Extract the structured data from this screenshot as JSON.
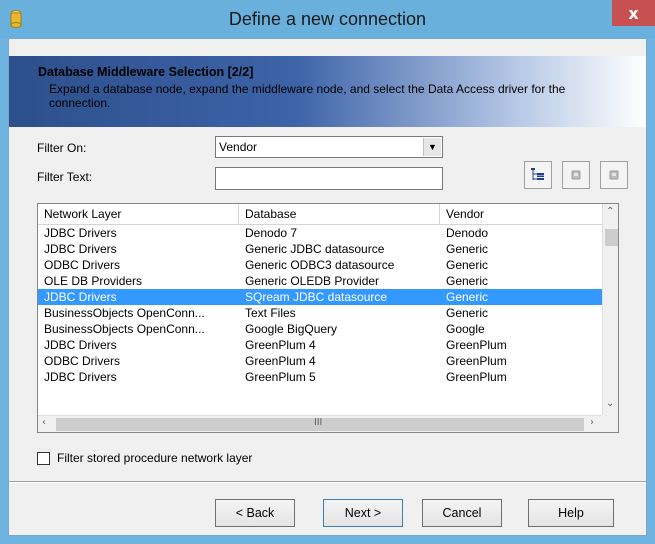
{
  "window": {
    "title": "Define a new connection",
    "close_label": "x"
  },
  "header": {
    "title": "Database Middleware Selection [2/2]",
    "description": "Expand a database node, expand the middleware node, and select the Data Access driver for the connection."
  },
  "filter": {
    "filter_on_label": "Filter On:",
    "filter_on_value": "Vendor",
    "filter_text_label": "Filter Text:",
    "filter_text_value": ""
  },
  "grid": {
    "columns": [
      "Network Layer",
      "Database",
      "Vendor"
    ],
    "rows": [
      {
        "network_layer": "JDBC Drivers",
        "database": "Denodo 7",
        "vendor": "Denodo",
        "selected": false
      },
      {
        "network_layer": "JDBC Drivers",
        "database": "Generic JDBC datasource",
        "vendor": "Generic",
        "selected": false
      },
      {
        "network_layer": "ODBC Drivers",
        "database": "Generic ODBC3 datasource",
        "vendor": "Generic",
        "selected": false
      },
      {
        "network_layer": "OLE DB Providers",
        "database": "Generic OLEDB Provider",
        "vendor": "Generic",
        "selected": false
      },
      {
        "network_layer": "JDBC Drivers",
        "database": "SQream JDBC datasource",
        "vendor": "Generic",
        "selected": true
      },
      {
        "network_layer": "BusinessObjects OpenConn...",
        "database": "Text Files",
        "vendor": "Generic",
        "selected": false
      },
      {
        "network_layer": "BusinessObjects OpenConn...",
        "database": "Google BigQuery",
        "vendor": "Google",
        "selected": false
      },
      {
        "network_layer": "JDBC Drivers",
        "database": "GreenPlum 4",
        "vendor": "GreenPlum",
        "selected": false
      },
      {
        "network_layer": "ODBC Drivers",
        "database": "GreenPlum 4",
        "vendor": "GreenPlum",
        "selected": false
      },
      {
        "network_layer": "JDBC Drivers",
        "database": "GreenPlum 5",
        "vendor": "GreenPlum",
        "selected": false
      }
    ],
    "hscroll_grip": "III"
  },
  "checkbox": {
    "label": "Filter stored procedure network layer",
    "checked": false
  },
  "buttons": {
    "back": "< Back",
    "next": "Next >",
    "cancel": "Cancel",
    "help": "Help"
  },
  "colors": {
    "titlebar": "#69b0dd",
    "selection": "#3399ff",
    "close": "#c75050"
  }
}
